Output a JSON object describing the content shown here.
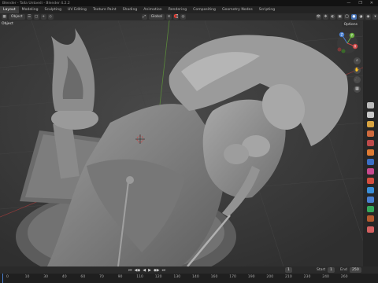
{
  "window": {
    "title": "Blender - Talla Untoedi - Blender 4.2.2",
    "controls": [
      "—",
      "❐",
      "✕"
    ]
  },
  "workspace_tabs": [
    {
      "label": "Layout",
      "active": true
    },
    {
      "label": "Modeling",
      "active": false
    },
    {
      "label": "Sculpting",
      "active": false
    },
    {
      "label": "UV Editing",
      "active": false
    },
    {
      "label": "Texture Paint",
      "active": false
    },
    {
      "label": "Shading",
      "active": false
    },
    {
      "label": "Animation",
      "active": false
    },
    {
      "label": "Rendering",
      "active": false
    },
    {
      "label": "Compositing",
      "active": false
    },
    {
      "label": "Geometry Nodes",
      "active": false
    },
    {
      "label": "Scripting",
      "active": false
    }
  ],
  "header": {
    "mode": "Object",
    "transform": "Global",
    "options": "Options"
  },
  "viewport": {
    "label": "Object",
    "background_color": "#3a3a3a",
    "model_color": "#8a8a8a"
  },
  "gizmo": {
    "x": "X",
    "y": "Y",
    "z": "Z"
  },
  "timeline": {
    "ticks": [
      "0",
      "10",
      "30",
      "40",
      "60",
      "70",
      "90",
      "110",
      "120",
      "130",
      "140",
      "160",
      "170",
      "190",
      "200",
      "210",
      "230",
      "240",
      "260"
    ],
    "current_frame": "1",
    "start_label": "Start",
    "start_value": "1",
    "end_label": "End",
    "end_value": "250"
  }
}
